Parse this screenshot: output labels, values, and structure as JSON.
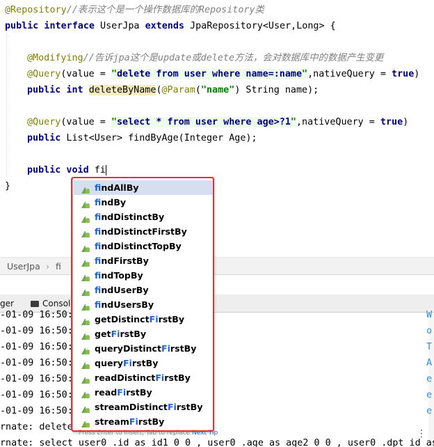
{
  "editor": {
    "l1_ann": "@Repository",
    "l1_cmt": "//表示这个是一个操作数据库的Repository类",
    "l2_kw1": "public interface",
    "l2_name": " UserJpa ",
    "l2_kw2": "extends",
    "l2_rest": " JpaRepository<User,Long> {",
    "l4_ann": "@Modifying",
    "l4_cmt": "//告诉jpa这个是update或delete方法，会对数据库中的数据产生变更",
    "l5_ann": "@Query",
    "l5_a": "(value = ",
    "l5_q": "\"",
    "l5_sql": "delete from user where name=:name",
    "l5_q2": "\"",
    "l5_b": ",nativeQuery = ",
    "l5_true": "true",
    "l5_c": ")",
    "l6_kw": "public int",
    "l6_method": "deleteByName",
    "l6_a": "(",
    "l6_ann": "@Param",
    "l6_b": "(",
    "l6_str": "\"name\"",
    "l6_c": ") String name);",
    "l8_ann": "@Query",
    "l8_a": "(value = ",
    "l8_q": "\"",
    "l8_sql": "select * from user where age>?1",
    "l8_q2": "\"",
    "l8_b": ",nativeQuery = ",
    "l8_true": "true",
    "l8_c": ")",
    "l9_kw": "public",
    "l9_rest": " List<User> findByAge(Integer Age);",
    "l11_kw": "public void",
    "l11_typed": " fi",
    "l12": "}"
  },
  "breadcrumb": {
    "file": "UserJpa",
    "sep": "›",
    "member": "fi"
  },
  "toolwindow": {
    "tab_left": "ger",
    "tab_console": "Console"
  },
  "console_lines": [
    "-01-09 16:50:0",
    "-01-09 16:50:0",
    "-01-09 16:50:0",
    "-01-09 16:50:0",
    "-01-09 16:50:1",
    "-01-09 16:50:1",
    "-01-09 16:50:1",
    "rnate: delete",
    "rnate: select user0_.id as id1_0_0_, user0_.age as age2_0_0_, user0_.dpt_id as"
  ],
  "console_right": [
    "W",
    "o",
    "T",
    "A",
    "e",
    "e",
    "e"
  ],
  "autocomplete": {
    "items": [
      {
        "pre": "",
        "match": "fi",
        "post": "ndAllBy"
      },
      {
        "pre": "",
        "match": "fi",
        "post": "ndBy"
      },
      {
        "pre": "",
        "match": "fi",
        "post": "ndDistinctBy"
      },
      {
        "pre": "",
        "match": "fi",
        "post": "ndDistinctFirstBy"
      },
      {
        "pre": "",
        "match": "fi",
        "post": "ndDistinctTopBy"
      },
      {
        "pre": "",
        "match": "fi",
        "post": "ndFirstBy"
      },
      {
        "pre": "",
        "match": "fi",
        "post": "ndTopBy"
      },
      {
        "pre": "",
        "match": "fi",
        "post": "ndUserBy"
      },
      {
        "pre": "",
        "match": "fi",
        "post": "ndUsersBy"
      },
      {
        "pre": "getDistinct",
        "match": "Fi",
        "post": "rstBy"
      },
      {
        "pre": "get",
        "match": "Fi",
        "post": "rstBy"
      },
      {
        "pre": "queryDistinct",
        "match": "Fi",
        "post": "rstBy"
      },
      {
        "pre": "query",
        "match": "Fi",
        "post": "rstBy"
      },
      {
        "pre": "readDistinct",
        "match": "Fi",
        "post": "rstBy"
      },
      {
        "pre": "read",
        "match": "Fi",
        "post": "rstBy"
      },
      {
        "pre": "streamDistinct",
        "match": "Fi",
        "post": "rstBy"
      },
      {
        "pre": "stream",
        "match": "Fi",
        "post": "rstBy"
      }
    ],
    "hint_text": "Press Enter to insert, Tab to replace",
    "hint_link": "Next Tip",
    "selected_index": 0,
    "icon": "method-icon"
  },
  "more_icon": "⋮"
}
